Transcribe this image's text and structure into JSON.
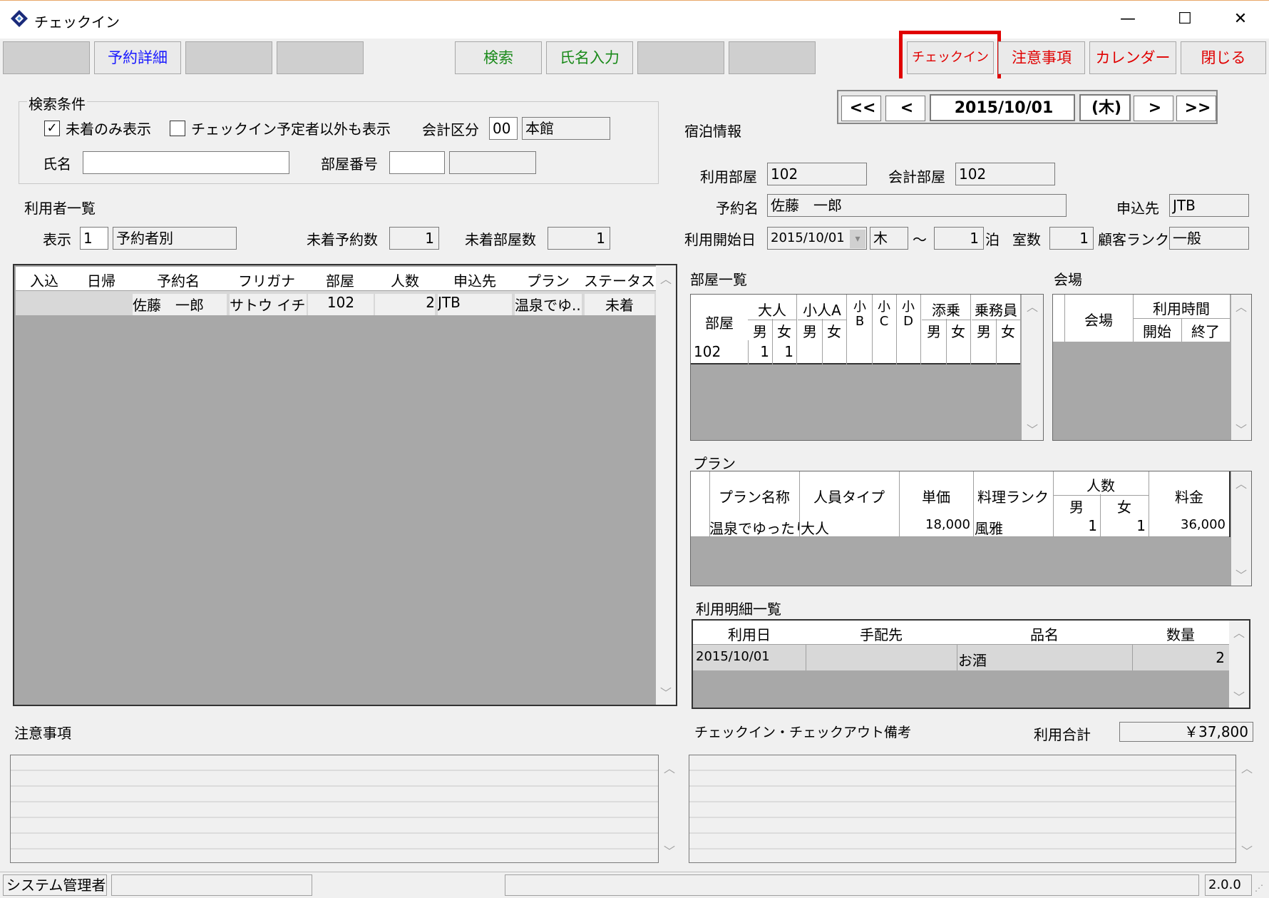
{
  "window": {
    "title": "チェックイン",
    "min": "—",
    "max": "☐",
    "close": "✕"
  },
  "toolbar": {
    "b1": "",
    "b2": "予約詳細",
    "b3": "",
    "b4": "",
    "b5": "検索",
    "b6": "氏名入力",
    "b7": "",
    "b8": "",
    "b9": "チェックイン",
    "b10": "注意事項",
    "b11": "カレンダー",
    "b12": "閉じる",
    "highlight_color": "#e00000"
  },
  "search": {
    "group": "検索条件",
    "only_unarrived": "未着のみ表示",
    "only_unarrived_checked": "✓",
    "show_others": "チェックイン予定者以外も表示",
    "account_label": "会計区分",
    "account_code": "00",
    "account_name": "本館",
    "name_label": "氏名",
    "name_value": "",
    "room_label": "部屋番号",
    "room_value": "",
    "room_name": ""
  },
  "users": {
    "title": "利用者一覧",
    "display_label": "表示",
    "display_code": "1",
    "display_name": "予約者別",
    "res_count_label": "未着予約数",
    "res_count": "1",
    "room_count_label": "未着部屋数",
    "room_count": "1",
    "headers": [
      "入込",
      "日帰",
      "予約名",
      "フリガナ",
      "部屋",
      "人数",
      "申込先",
      "プラン",
      "ステータス"
    ],
    "rows": [
      [
        "",
        "",
        "佐藤　一郎",
        "サトウ イチ...",
        "102",
        "2",
        "JTB",
        "温泉でゆ...",
        "未着"
      ]
    ]
  },
  "date_nav": {
    "first": "<<",
    "prev": "<",
    "date": "2015/10/01",
    "weekday": "(木)",
    "next": ">",
    "last": ">>"
  },
  "stay": {
    "title": "宿泊情報",
    "use_room_label": "利用部屋",
    "use_room": "102",
    "acc_room_label": "会計部屋",
    "acc_room": "102",
    "res_name_label": "予約名",
    "res_name": "佐藤　一郎",
    "agent_label": "申込先",
    "agent": "JTB",
    "start_label": "利用開始日",
    "start_date": "2015/10/01",
    "start_wd": "木",
    "tilde": "～",
    "nights": "1",
    "nights_unit": "泊",
    "rooms_label": "室数",
    "rooms": "1",
    "rank_label": "顧客ランク",
    "rank": "一般"
  },
  "rooms": {
    "title": "部屋一覧",
    "h_room": "部屋",
    "h_adult": "大人",
    "h_childA": "小人A",
    "h_m": "男",
    "h_f": "女",
    "h_b": "小\nB",
    "h_c": "小\nC",
    "h_d": "小\nD",
    "h_attend": "添乗",
    "h_crew": "乗務員",
    "row": {
      "room": "102",
      "am": "1",
      "af": "1"
    }
  },
  "venue": {
    "title": "会場",
    "h_venue": "会場",
    "h_time": "利用時間",
    "h_start": "開始",
    "h_end": "終了"
  },
  "plan": {
    "title": "プラン",
    "h_name": "プラン名称",
    "h_type": "人員タイプ",
    "h_price": "単価",
    "h_rank": "料理ランク",
    "h_count": "人数",
    "h_m": "男",
    "h_f": "女",
    "h_fee": "料金",
    "row": {
      "name": "温泉でゆったり",
      "type": "大人",
      "price": "18,000",
      "rank": "風雅",
      "m": "1",
      "f": "1",
      "fee": "36,000"
    }
  },
  "details": {
    "title": "利用明細一覧",
    "headers": [
      "利用日",
      "手配先",
      "品名",
      "数量"
    ],
    "row": [
      "2015/10/01",
      "",
      "お酒",
      "2"
    ]
  },
  "notes": {
    "title": "注意事項"
  },
  "remarks": {
    "title": "チェックイン・チェックアウト備考",
    "total_label": "利用合計",
    "total": "￥37,800"
  },
  "status": {
    "user": "システム管理者",
    "version": "2.0.0"
  }
}
